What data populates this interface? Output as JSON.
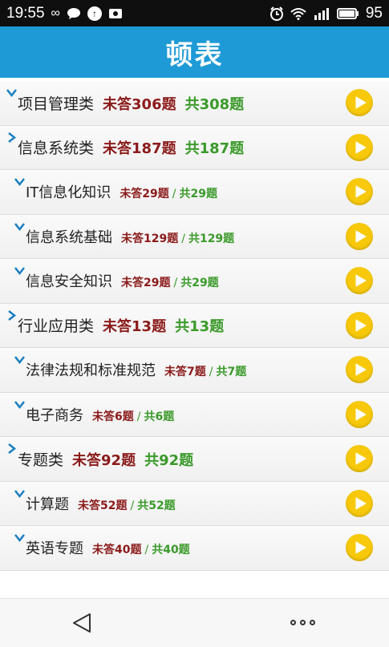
{
  "status_bar": {
    "time": "19:55",
    "left_icons": [
      "infinity-icon",
      "chat-icon",
      "upload-icon",
      "photo-icon"
    ],
    "right_icons": [
      "alarm-icon",
      "wifi-icon",
      "signal-icon",
      "battery-icon"
    ],
    "battery": "95"
  },
  "header": {
    "title": "顿表"
  },
  "items": [
    {
      "level": 0,
      "title": "项目管理类",
      "unanswered": "未答306题",
      "total": "共308题",
      "expanded": true
    },
    {
      "level": 0,
      "title": "信息系统类",
      "unanswered": "未答187题",
      "total": "共187题",
      "expanded": false
    },
    {
      "level": 1,
      "title": "IT信息化知识",
      "unanswered": "未答29题",
      "sep": "/",
      "total": "共29题",
      "expanded": true
    },
    {
      "level": 1,
      "title": "信息系统基础",
      "unanswered": "未答129题",
      "sep": "/",
      "total": "共129题",
      "expanded": true
    },
    {
      "level": 1,
      "title": "信息安全知识",
      "unanswered": "未答29题",
      "sep": "/",
      "total": "共29题",
      "expanded": true
    },
    {
      "level": 0,
      "title": "行业应用类",
      "unanswered": "未答13题",
      "total": "共13题",
      "expanded": false
    },
    {
      "level": 1,
      "title": "法律法规和标准规范",
      "unanswered": "未答7题",
      "sep": "/",
      "total": "共7题",
      "expanded": true
    },
    {
      "level": 1,
      "title": "电子商务",
      "unanswered": "未答6题",
      "sep": "/",
      "total": "共6题",
      "expanded": true
    },
    {
      "level": 0,
      "title": "专题类",
      "unanswered": "未答92题",
      "total": "共92题",
      "expanded": false
    },
    {
      "level": 1,
      "title": "计算题",
      "unanswered": "未答52题",
      "sep": "/",
      "total": "共52题",
      "expanded": true
    },
    {
      "level": 1,
      "title": "英语专题",
      "unanswered": "未答40题",
      "sep": "/",
      "total": "共40题",
      "expanded": true
    }
  ],
  "colors": {
    "header": "#1e9ad6",
    "unanswered": "#8b1a1a",
    "total": "#3a9a2a",
    "play_button": "#f7c90a",
    "chevron": "#1a7fc1"
  },
  "nav_bar": {
    "icons": [
      "back-icon",
      "more-icon"
    ]
  }
}
